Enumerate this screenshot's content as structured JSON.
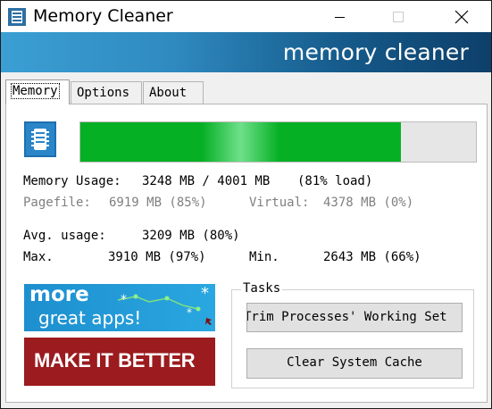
{
  "window": {
    "title": "Memory Cleaner"
  },
  "banner": {
    "text": "memory cleaner"
  },
  "tabs": [
    {
      "label": "Memory",
      "active": true
    },
    {
      "label": "Options",
      "active": false
    },
    {
      "label": "About",
      "active": false
    }
  ],
  "memory": {
    "progress_percent": 81,
    "usage_label": "Memory Usage:",
    "usage_value": "3248 MB / 4001 MB",
    "usage_load": "(81% load)",
    "pagefile_label": "Pagefile:",
    "pagefile_value": "6919 MB (85%)",
    "virtual_label": "Virtual:",
    "virtual_value": "4378 MB (0%)",
    "avg_label": "Avg. usage:",
    "avg_value": "3209 MB (80%)",
    "max_label": "Max.",
    "max_value": "3910 MB (97%)",
    "min_label": "Min.",
    "min_value": "2643 MB (66%)"
  },
  "promo": {
    "line1": "more",
    "line2": "great apps!",
    "make_better": "MAKE IT BETTER"
  },
  "tasks": {
    "label": "Tasks",
    "trim_button": "Trim Processes' Working Set",
    "clear_button": "Clear System Cache"
  },
  "colors": {
    "progress_fill": "#06b025",
    "banner": "#2f8ac0",
    "make_better_bg": "#9b1b1f"
  }
}
